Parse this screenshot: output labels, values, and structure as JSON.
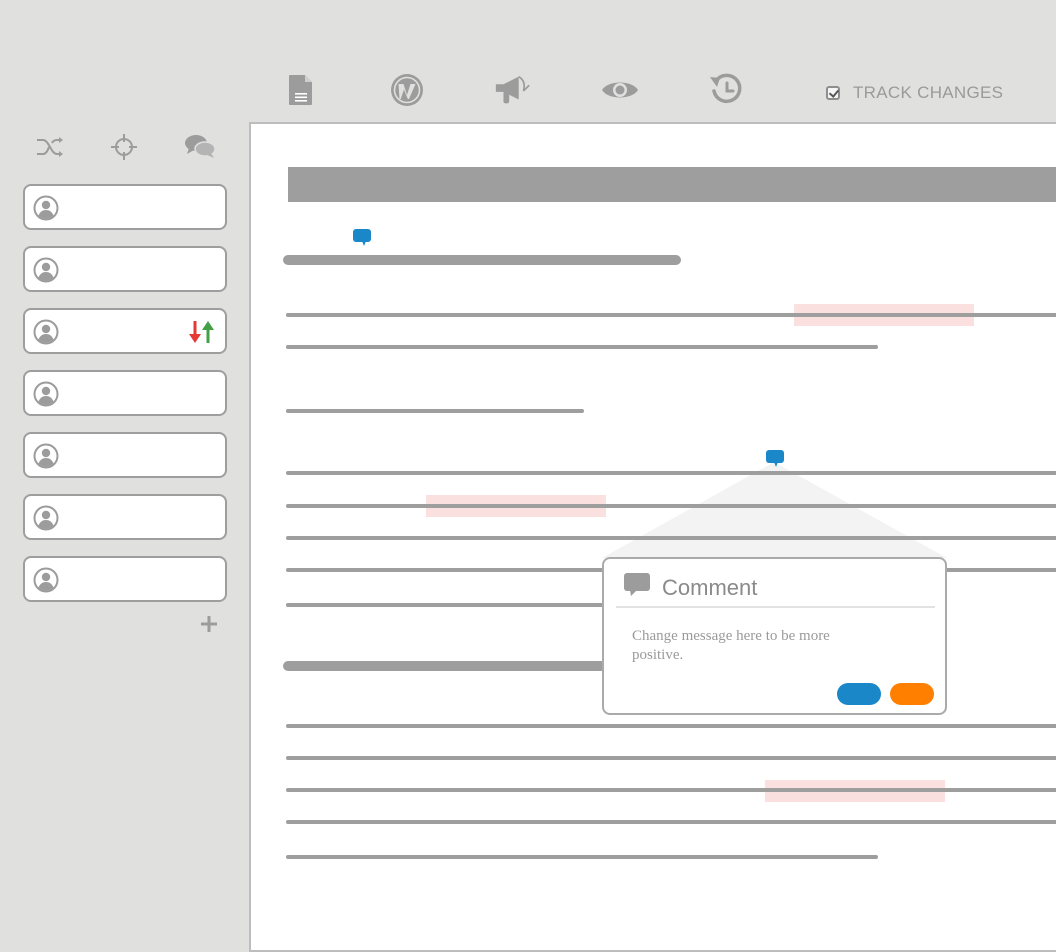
{
  "toolbar": {
    "icons": [
      "document-icon",
      "wordpress-icon",
      "megaphone-icon",
      "eye-icon",
      "history-icon"
    ],
    "track_changes_label": "TRACK CHANGES",
    "track_changes_checked": true
  },
  "sidebar": {
    "icons": [
      "shuffle-icon",
      "crosshair-icon",
      "chat-bubbles-icon"
    ],
    "users": [
      {
        "has_swap": false
      },
      {
        "has_swap": false
      },
      {
        "has_swap": true
      },
      {
        "has_swap": false
      },
      {
        "has_swap": false
      },
      {
        "has_swap": false
      },
      {
        "has_swap": false
      }
    ]
  },
  "comment": {
    "title": "Comment",
    "text": "Change message here to be more positive.",
    "buttons": [
      "confirm-button",
      "cancel-button"
    ]
  },
  "colors": {
    "background": "#e0e0df",
    "line": "#9e9e9e",
    "highlight": "#f8d7d4",
    "accent_blue": "#1a87c9",
    "accent_orange": "#ff8000",
    "swap_down": "#e53935",
    "swap_up": "#43a047"
  }
}
